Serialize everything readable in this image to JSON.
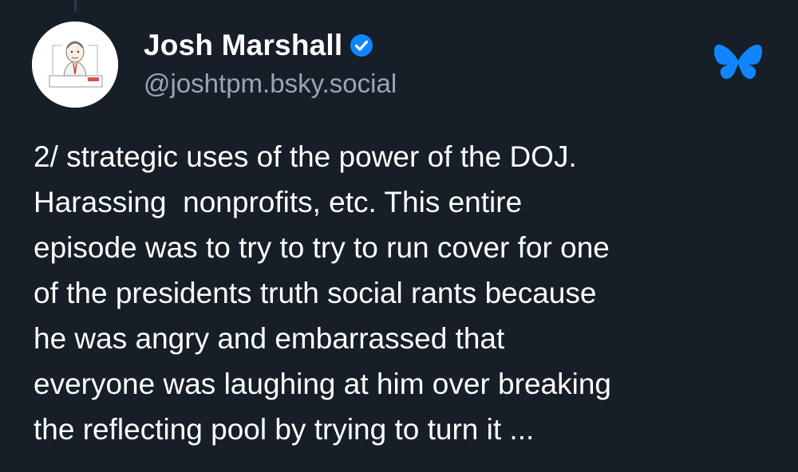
{
  "author": {
    "display_name": "Josh Marshall",
    "handle": "@joshtpm.bsky.social",
    "avatar_icon": "caricature-avatar",
    "verified_icon": "verified-check-icon"
  },
  "app": {
    "logo_icon": "bluesky-butterfly-icon",
    "brand_color": "#1185fe"
  },
  "colors": {
    "background": "#161e27",
    "text": "#ffffff",
    "handle": "#9aa6b2",
    "verified": "#1185fe"
  },
  "post": {
    "lines": [
      "2/ strategic uses of the power of the DOJ.",
      "Harassing  nonprofits, etc. This entire",
      "episode was to try to try to run cover for one",
      "of the presidents truth social rants because",
      "he was angry and embarrassed that",
      "everyone was laughing at him over breaking",
      "the reflecting pool by trying to turn it ..."
    ]
  }
}
